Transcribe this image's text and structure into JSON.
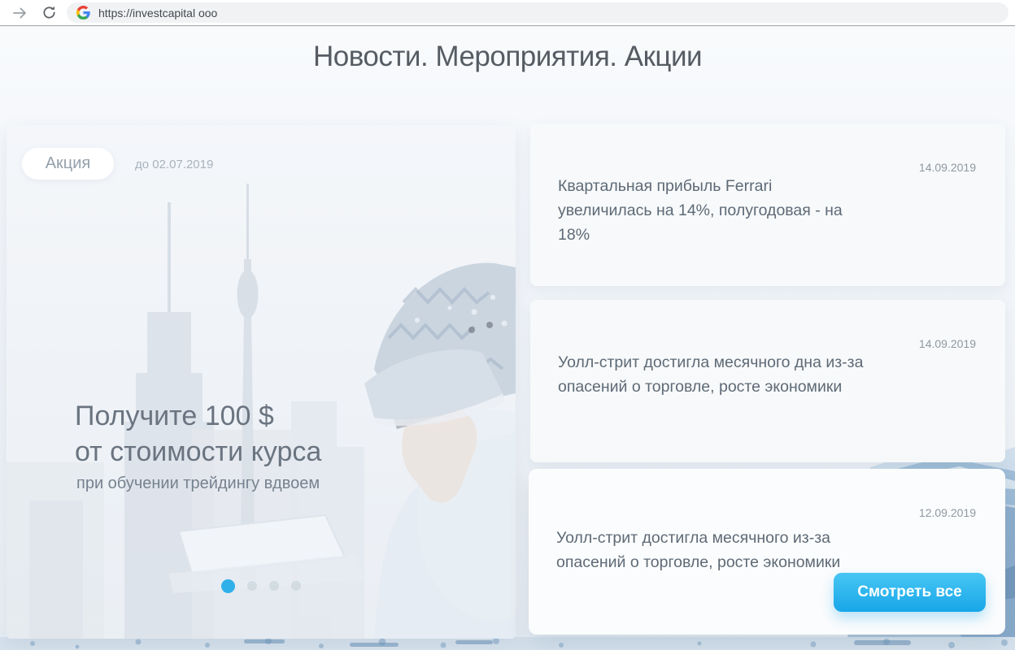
{
  "browser": {
    "url": "https://investcapital ooo",
    "icons": {
      "forward": "forward-arrow",
      "reload": "circular-arrow",
      "favicon": "google-g"
    }
  },
  "page": {
    "title": "Новости. Мероприятия. Акции"
  },
  "promo": {
    "badge": "Акция",
    "deadline": "до 02.07.2019",
    "headline_line1": "Получите 100 $",
    "headline_line2": "от стоимости курса",
    "subtitle": "при обучении трейдингу вдвоем",
    "dots": {
      "count": 4,
      "active_index": 0
    }
  },
  "news": {
    "items": [
      {
        "date": "14.09.2019",
        "title": "Квартальная прибыль Ferrari увеличилась на 14%, полугодовая - на 18%"
      },
      {
        "date": "14.09.2019",
        "title": "Уолл-стрит достигла месячного дна из-за опасений о торговле, росте экономики"
      },
      {
        "date": "12.09.2019",
        "title": "Уолл-стрит достигла месячного из-за опасений о торговле, росте экономики"
      }
    ],
    "view_all_label": "Смотреть все"
  },
  "colors": {
    "accent_blue": "#18a6e8",
    "active_dot": "#2fb0e8",
    "inactive_dot": "#ccd5dd",
    "title_text": "#565c63",
    "news_text": "#5e6a76",
    "date_text": "#8f98a2",
    "url_bar_bg": "#f0f2f4",
    "ice_tint": "#8fb2d0"
  }
}
